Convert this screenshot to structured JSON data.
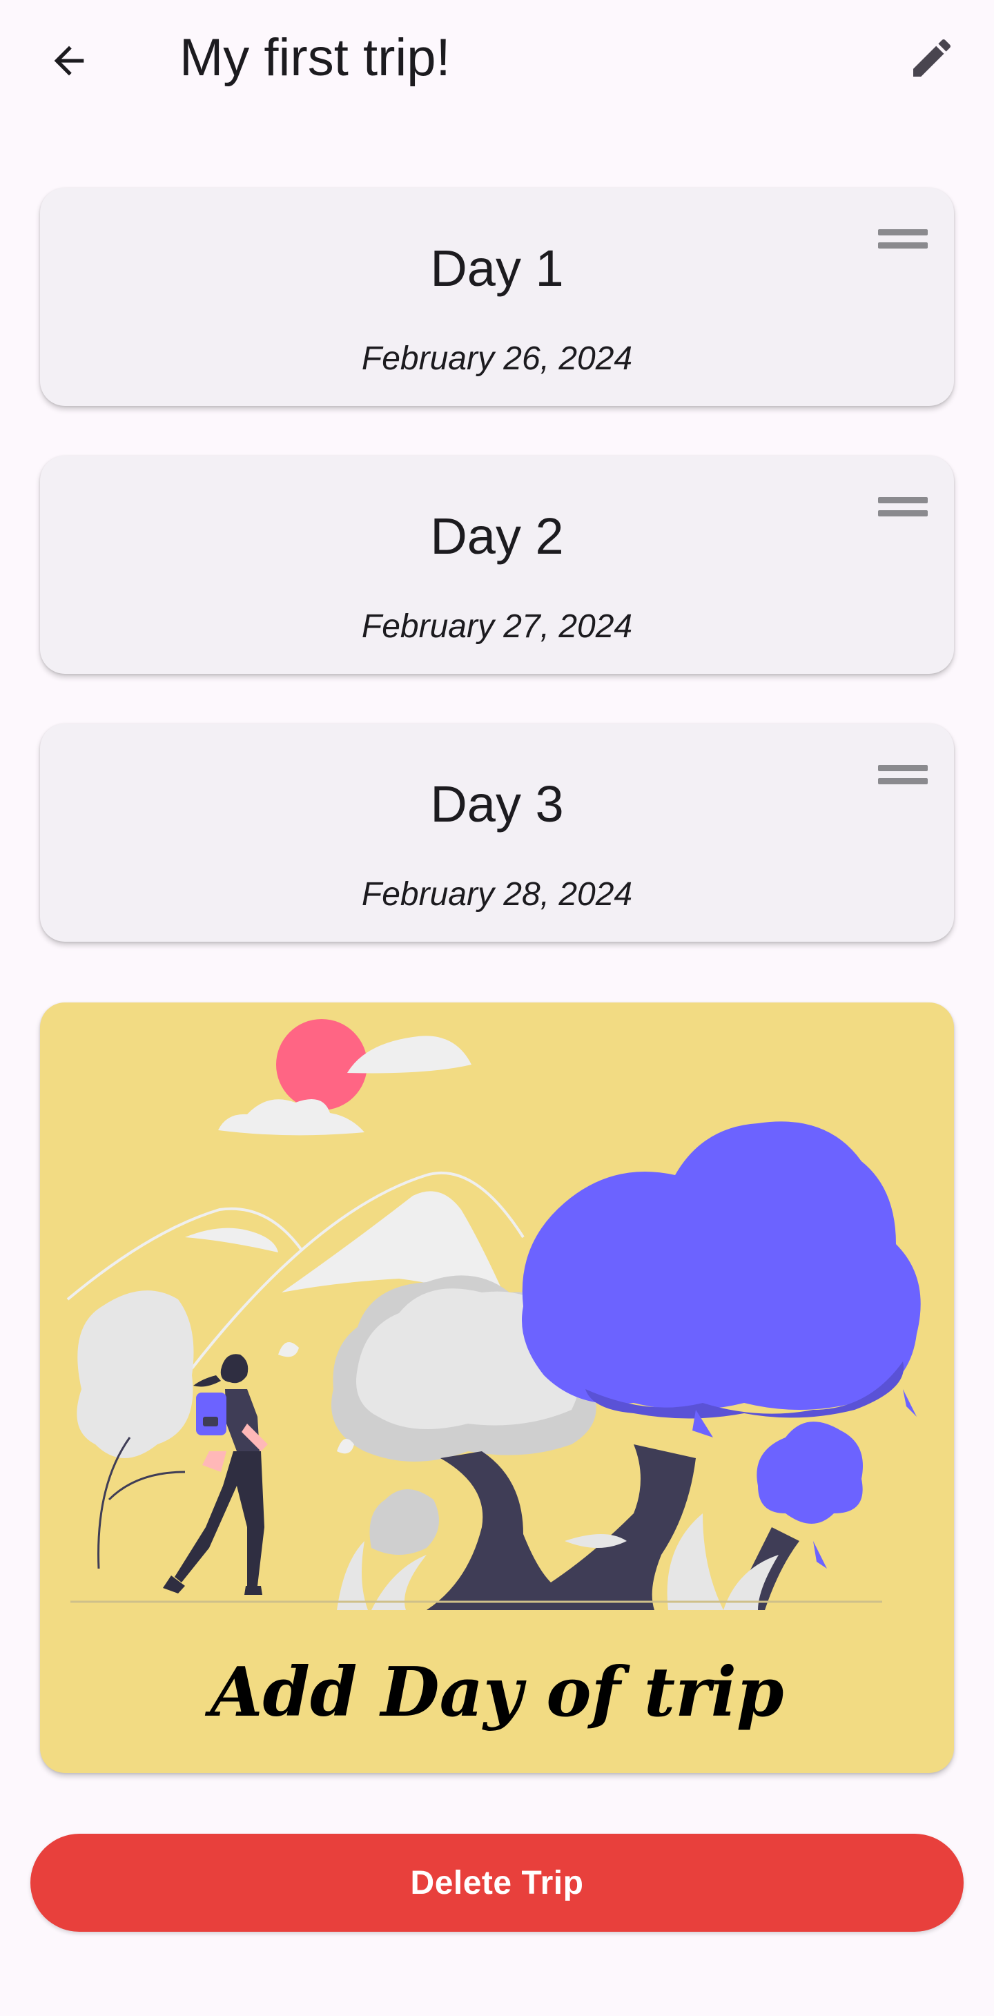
{
  "appbar": {
    "title": "My first trip!",
    "back_icon": "arrow-back-icon",
    "edit_icon": "pencil-edit-icon"
  },
  "days": [
    {
      "title": "Day 1",
      "date": "February 26, 2024"
    },
    {
      "title": "Day 2",
      "date": "February 27, 2024"
    },
    {
      "title": "Day 3",
      "date": "February 28, 2024"
    }
  ],
  "add_day": {
    "label": "Add Day of trip"
  },
  "delete_button": {
    "label": "Delete Trip"
  },
  "colors": {
    "background": "#fdf8fd",
    "card": "#f3f0f5",
    "add_card": "#f2db83",
    "delete": "#e8403c",
    "accent_purple": "#6c63ff",
    "sun": "#ff6584"
  }
}
